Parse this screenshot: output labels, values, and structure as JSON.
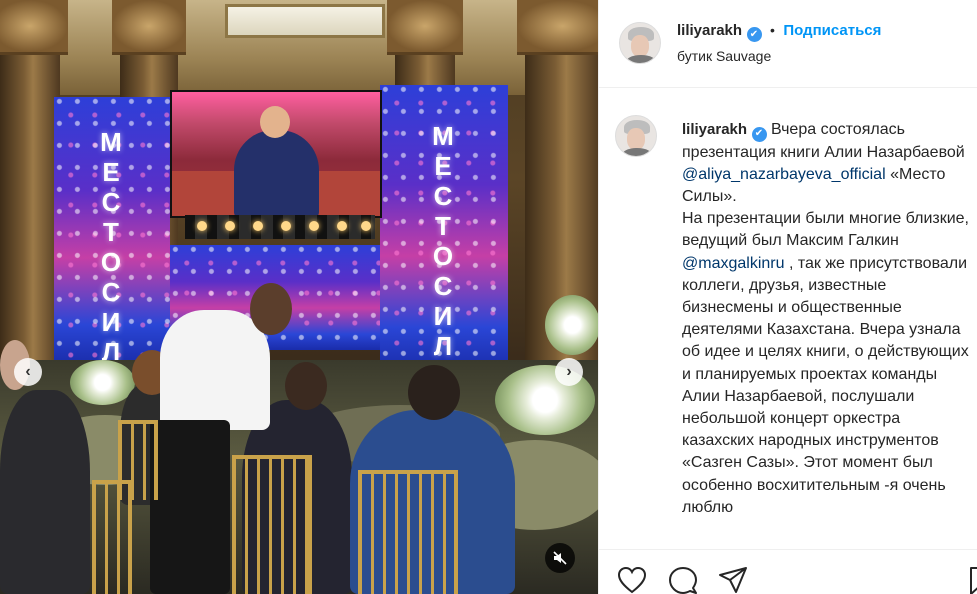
{
  "post": {
    "username": "liliyarakh",
    "verified_mark": "✔",
    "separator": "•",
    "follow_label": "Подписаться",
    "location": "бутик Sauvage"
  },
  "media": {
    "screen_text_left": "МЕСТО СИЛЫ",
    "screen_text_right": "МЕСТО СИЛЫ",
    "prev_icon": "chevron-left-icon",
    "next_icon": "chevron-right-icon",
    "mute_icon": "speaker-muted-icon"
  },
  "caption": {
    "part1": "Вчера состоялась презентация книги Алии Назарбаевой ",
    "mention1": "@aliya_nazarbayeva_official",
    "part2": " «Место Силы».",
    "part3": "На презентации были многие близкие, ведущий был Максим Галкин ",
    "mention2": "@maxgalkinru",
    "part4": " , так же присутствовали коллеги, друзья, известные бизнесмены и общественные деятелями Казахстана. Вчера узнала об идее и целях книги, о действующих и планируемых проектах команды Алии Назарбаевой, послушали небольшой концерт оркестра казахских народных инструментов «Сазген Сазы». Этот момент был особенно восхитительным -я очень люблю"
  },
  "actions": {
    "like_icon": "heart-icon",
    "comment_icon": "comment-icon",
    "share_icon": "share-icon",
    "save_icon": "bookmark-icon"
  },
  "colors": {
    "follow": "#0095f6",
    "mention": "#00376b",
    "verified": "#3897f0",
    "text": "#262626",
    "border": "#efefef"
  }
}
